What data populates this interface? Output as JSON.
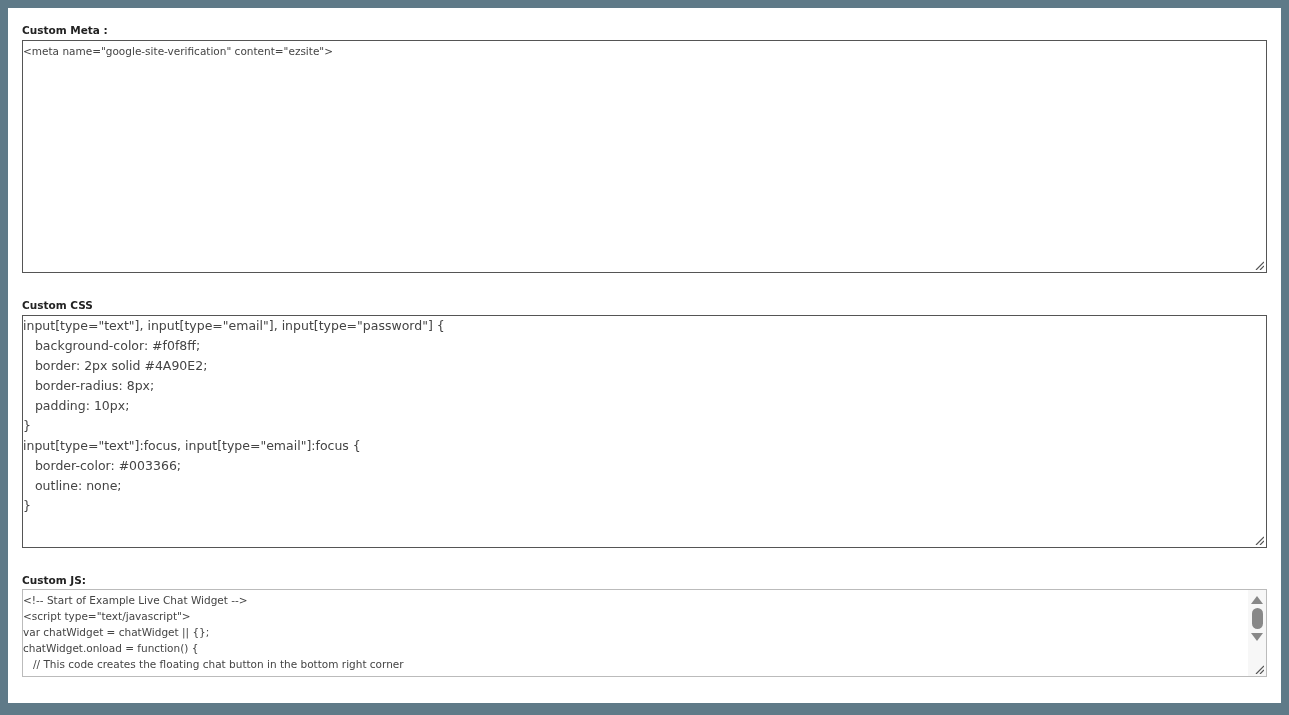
{
  "sections": [
    {
      "label": "Custom Meta :",
      "kind": "meta",
      "lines": [
        "<meta name=\"google-site-verification\" content=\"ezsite\">"
      ]
    },
    {
      "label": "Custom CSS",
      "kind": "style",
      "lines": [
        "input[type=\"text\"], input[type=\"email\"], input[type=\"password\"] {",
        "   background-color: #f0f8ff;",
        "   border: 2px solid #4A90E2;",
        "   border-radius: 8px;",
        "   padding: 10px;",
        "}",
        "input[type=\"text\"]:focus, input[type=\"email\"]:focus {",
        "   border-color: #003366;",
        "   outline: none;",
        "}"
      ]
    },
    {
      "label": "Custom JS:",
      "kind": "script",
      "lines": [
        "<!-- Start of Example Live Chat Widget -->",
        "<script type=\"text/javascript\">",
        "var chatWidget = chatWidget || {};",
        "chatWidget.onload = function() {",
        "   // This code creates the floating chat button in the bottom right corner"
      ]
    }
  ]
}
